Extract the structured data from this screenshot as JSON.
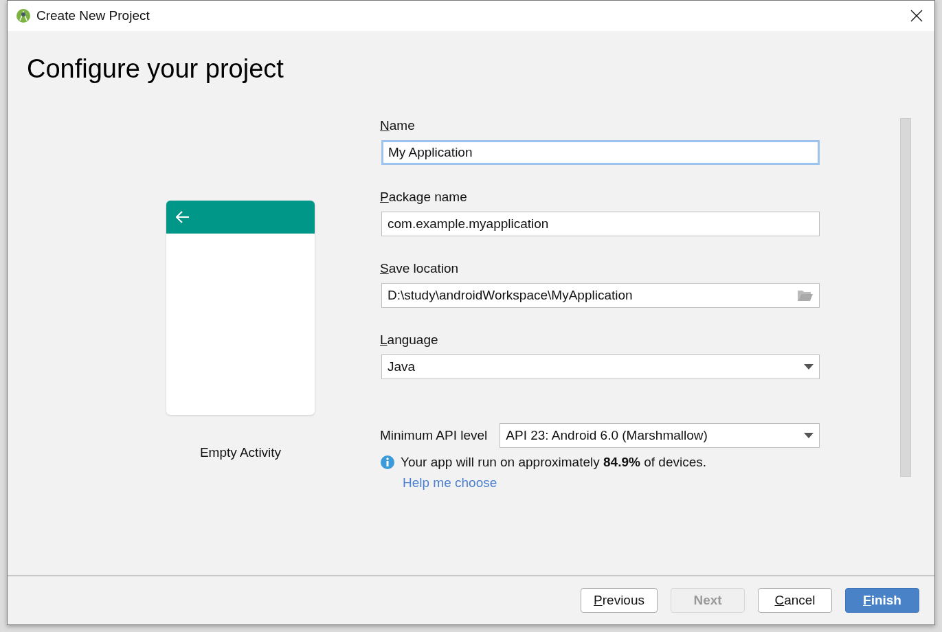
{
  "window": {
    "title": "Create New Project"
  },
  "heading": "Configure your project",
  "template": {
    "label": "Empty Activity"
  },
  "fields": [
    {
      "kind": "text",
      "key": "N",
      "rest": "ame",
      "value": "My Application",
      "focused": true
    },
    {
      "kind": "text",
      "key": "P",
      "rest": "ackage name",
      "value": "com.example.myapplication",
      "focused": false
    },
    {
      "kind": "folder",
      "key": "S",
      "rest": "ave location",
      "value": "D:\\study\\androidWorkspace\\MyApplication",
      "focused": false
    },
    {
      "kind": "dropdown",
      "key": "L",
      "rest": "anguage",
      "value": "Java",
      "focused": false
    }
  ],
  "api": {
    "label": "Minimum API level",
    "value": "API 23: Android 6.0 (Marshmallow)"
  },
  "info": "Your app will run on approximately **84.9%** of devices.",
  "help_link": "Help me choose",
  "buttons": [
    {
      "key": "P",
      "rest": "revious",
      "disabled": false,
      "default": false
    },
    {
      "rest": "Next",
      "disabled": true,
      "default": false
    },
    {
      "key": "C",
      "rest": "ancel",
      "disabled": false,
      "default": false
    },
    {
      "key": "F",
      "rest": "inish",
      "disabled": false,
      "default": true
    }
  ]
}
